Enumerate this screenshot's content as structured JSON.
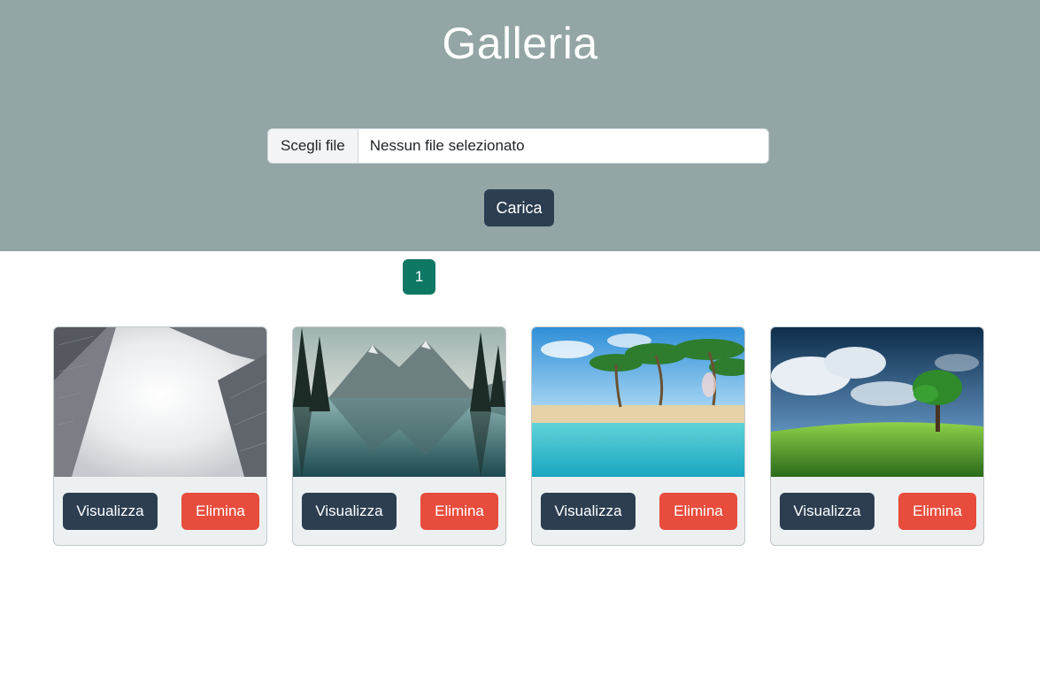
{
  "header": {
    "title": "Galleria"
  },
  "upload": {
    "choose_file_label": "Scegli file",
    "no_file_text": "Nessun file selezionato",
    "upload_button": "Carica"
  },
  "pagination": {
    "current_page": "1"
  },
  "gallery": {
    "cards": [
      {
        "image": "skyscrapers-fog",
        "view_label": "Visualizza",
        "delete_label": "Elimina"
      },
      {
        "image": "mountain-lake",
        "view_label": "Visualizza",
        "delete_label": "Elimina"
      },
      {
        "image": "tropical-beach",
        "view_label": "Visualizza",
        "delete_label": "Elimina"
      },
      {
        "image": "green-field-tree",
        "view_label": "Visualizza",
        "delete_label": "Elimina"
      }
    ]
  },
  "colors": {
    "hero_bg": "#93a5a5",
    "primary": "#2c3e50",
    "danger": "#e74c3c",
    "pagination_active": "#0f7864",
    "card_bg": "#ecf0f1"
  }
}
